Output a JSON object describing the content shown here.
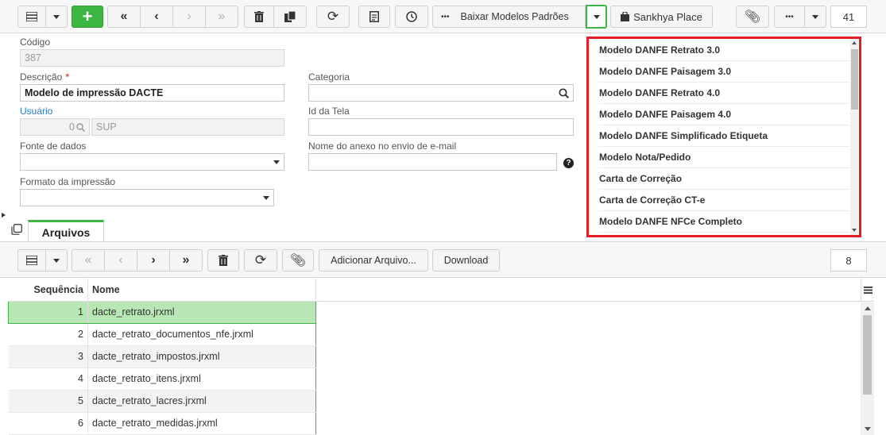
{
  "toolbar": {
    "more_label": "•••",
    "baixar_label": "Baixar Modelos Padrões",
    "sankhya_label": "Sankhya Place",
    "count": "41"
  },
  "form": {
    "codigo_label": "Código",
    "codigo_value": "387",
    "descricao_label": "Descrição",
    "required_mark": "*",
    "descricao_value": "Modelo de impressão DACTE",
    "usuario_label": "Usuário",
    "usuario_code": "0",
    "usuario_name": "SUP",
    "fonte_label": "Fonte de dados",
    "fonte_value": "",
    "formato_label": "Formato da impressão",
    "formato_value": "",
    "categoria_label": "Categoria",
    "categoria_value": "",
    "idtela_label": "Id da Tela",
    "idtela_value": "",
    "anexo_label": "Nome do anexo no envio de e-mail",
    "anexo_value": ""
  },
  "dropdown": {
    "items": [
      "Modelo DANFE Retrato 3.0",
      "Modelo DANFE Paisagem 3.0",
      "Modelo DANFE Retrato 4.0",
      "Modelo DANFE Paisagem 4.0",
      "Modelo DANFE Simplificado Etiqueta",
      "Modelo Nota/Pedido",
      "Carta de Correção",
      "Carta de Correção CT-e",
      "Modelo DANFE NFCe Completo"
    ]
  },
  "tabs": {
    "arquivos": "Arquivos"
  },
  "files_toolbar": {
    "add_label": "Adicionar Arquivo...",
    "download_label": "Download",
    "count": "8"
  },
  "grid": {
    "headers": {
      "seq": "Sequência",
      "nome": "Nome"
    },
    "rows": [
      {
        "seq": "1",
        "nome": "dacte_retrato.jrxml"
      },
      {
        "seq": "2",
        "nome": "dacte_retrato_documentos_nfe.jrxml"
      },
      {
        "seq": "3",
        "nome": "dacte_retrato_impostos.jrxml"
      },
      {
        "seq": "4",
        "nome": "dacte_retrato_itens.jrxml"
      },
      {
        "seq": "5",
        "nome": "dacte_retrato_lacres.jrxml"
      },
      {
        "seq": "6",
        "nome": "dacte_retrato_medidas.jrxml"
      }
    ]
  },
  "colors": {
    "accent": "#3cb543",
    "highlight_border": "#e41e26",
    "link": "#2a7bbf",
    "selected_row": "#b8e6b4"
  }
}
